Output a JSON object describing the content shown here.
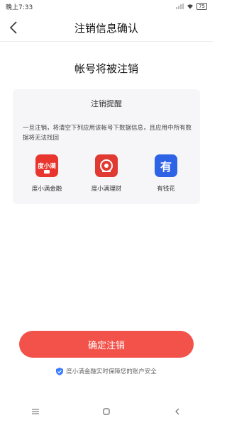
{
  "status_bar": {
    "time": "晚上7:33",
    "battery": "75"
  },
  "nav": {
    "title": "注销信息确认"
  },
  "heading": "帐号将被注销",
  "card": {
    "title": "注销提醒",
    "desc": "一旦注销，将清空下列应用该帐号下数据信息，且应用中所有数据将无法找回",
    "apps": [
      {
        "icon_text": "度小满",
        "label": "度小满金融",
        "color": "#e8352e"
      },
      {
        "icon_text": "",
        "label": "度小满理财",
        "color": "#e03a32"
      },
      {
        "icon_text": "有",
        "label": "有钱花",
        "color": "#2e63e6"
      }
    ]
  },
  "confirm_button": "确定注销",
  "security_note": "度小满金融实时保障您的账户安全",
  "colors": {
    "accent": "#f2524a",
    "shield": "#3b7cff"
  }
}
